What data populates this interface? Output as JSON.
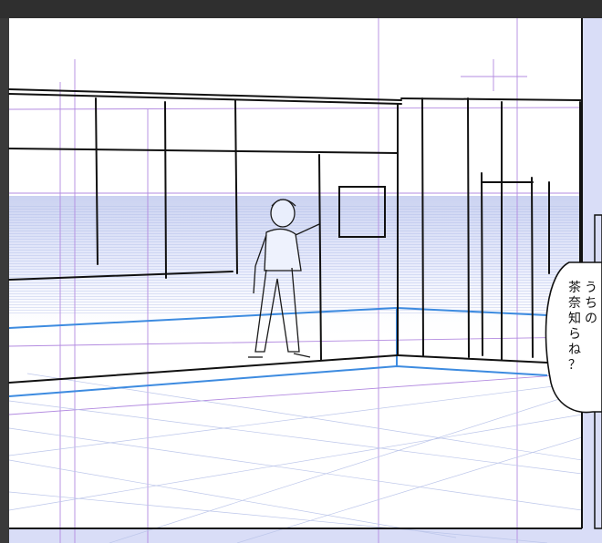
{
  "app": "illustration-canvas",
  "speech_bubble": {
    "column_right": [
      "う",
      "ち",
      "の"
    ],
    "column_left": [
      "茶",
      "奈",
      "知",
      "ら",
      "ね",
      "？"
    ]
  },
  "colors": {
    "paper": "#ffffff",
    "margin": "#d9ddf7",
    "guide": "#b38be0",
    "perspective": "#3d8be0",
    "ink": "#111111"
  }
}
